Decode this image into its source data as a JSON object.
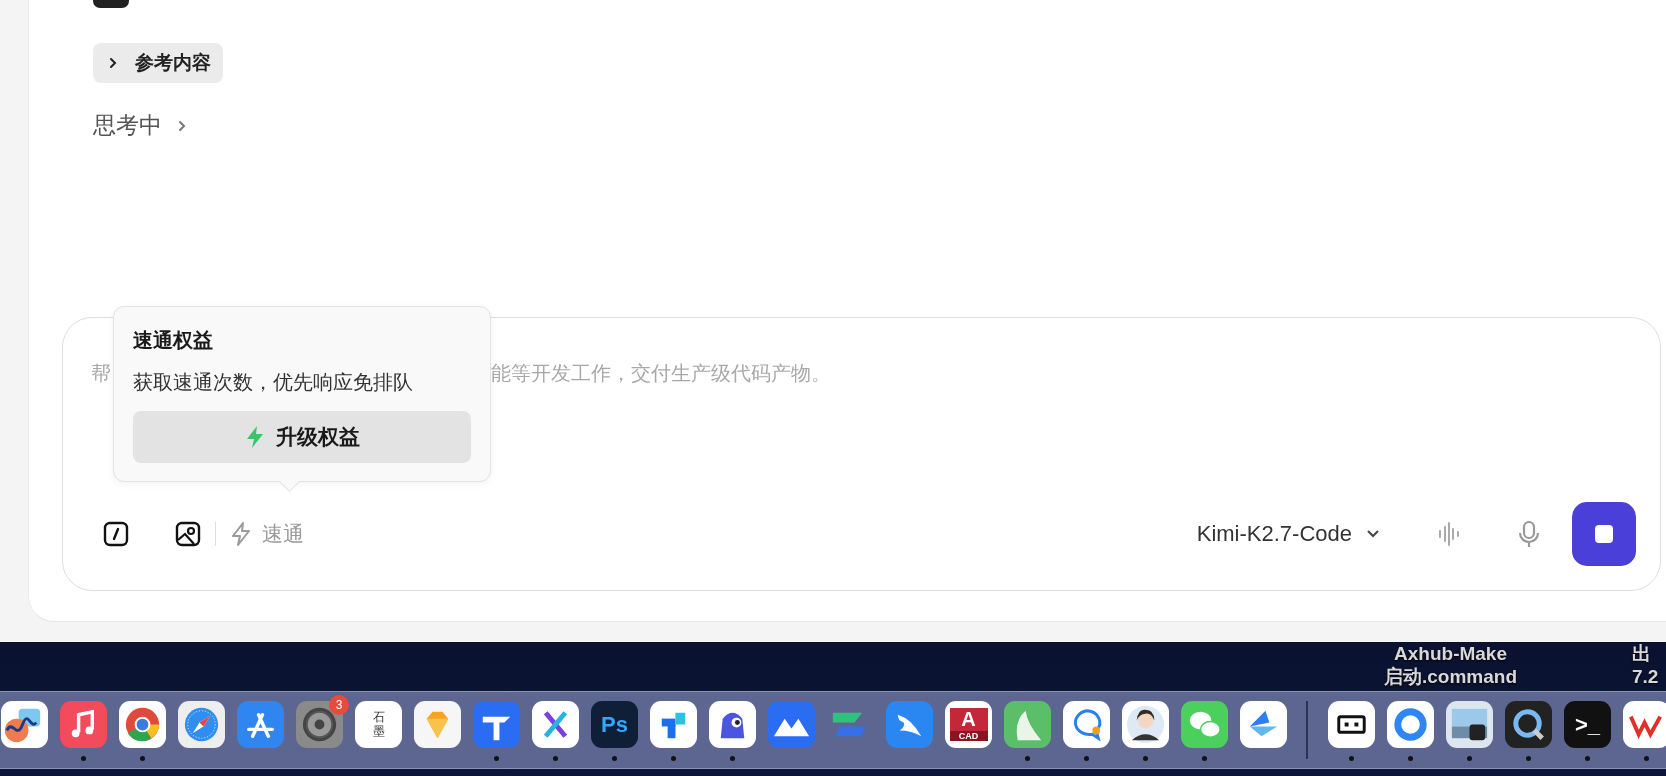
{
  "conversation": {
    "reference_chip": {
      "label": "参考内容",
      "expanded": false
    },
    "thinking": {
      "label": "思考中",
      "expanded": false
    }
  },
  "composer": {
    "placeholder_start": "帮",
    "placeholder_end": "能等开发工作，交付生产级代码产物。",
    "tooltip": {
      "title": "速通权益",
      "description": "获取速通次数，优先响应免排队",
      "button": "升级权益"
    },
    "speed_label": "速通",
    "model": "Kimi-K2.7-Code",
    "generating": true
  },
  "desktop_labels": [
    {
      "lines": [
        "Axhub-Make",
        "启动.command"
      ]
    },
    {
      "lines": [
        "出",
        "7.2"
      ]
    }
  ],
  "dock": {
    "apps": [
      {
        "running": false
      },
      {
        "running": true
      },
      {
        "running": true
      },
      {
        "running": false
      },
      {
        "running": false
      },
      {
        "running": false,
        "badge": "3"
      },
      {
        "running": false,
        "logo_text": "石墨"
      },
      {
        "running": false
      },
      {
        "running": true
      },
      {
        "running": true
      },
      {
        "running": true,
        "logo_text": "Ps"
      },
      {
        "running": true
      },
      {
        "running": true
      },
      {
        "running": false
      },
      {
        "running": false
      },
      {
        "running": false
      },
      {
        "running": false,
        "logo_text": "A",
        "logo_subtext": "CAD"
      },
      {
        "running": true
      },
      {
        "running": true
      },
      {
        "running": true
      },
      {
        "running": true
      },
      {
        "running": false
      }
    ],
    "recent": [
      {
        "running": true
      },
      {
        "running": true
      },
      {
        "running": true
      },
      {
        "running": true
      },
      {
        "running": true,
        "logo_text": ">_"
      },
      {
        "running": true
      }
    ]
  }
}
